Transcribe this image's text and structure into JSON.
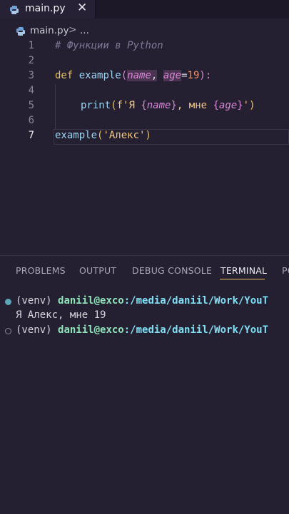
{
  "tab": {
    "filename": "main.py",
    "close_glyph": "✕"
  },
  "breadcrumb": {
    "file": "main.py",
    "separator": ">",
    "more": "..."
  },
  "editor": {
    "line_numbers": [
      "1",
      "2",
      "3",
      "4",
      "5",
      "6",
      "7"
    ],
    "line1": {
      "comment": "# Функции в Python"
    },
    "line3": {
      "kw": "def",
      "fn": "example",
      "open": "(",
      "p1": "name",
      "comma": ",",
      "p2": "age",
      "eq": "=",
      "num": "19",
      "close": "):"
    },
    "line5": {
      "fn": "print",
      "open": "(",
      "s1": "f'Я ",
      "b1o": "{",
      "v1": "name",
      "b1c": "}",
      "s2": ", мне ",
      "b2o": "{",
      "v2": "age",
      "b2c": "}",
      "s3": "'",
      "close": ")"
    },
    "line7": {
      "fn": "example",
      "open": "(",
      "str": "'Алекс'",
      "close": ")"
    }
  },
  "panel": {
    "tabs": [
      "PROBLEMS",
      "OUTPUT",
      "DEBUG CONSOLE",
      "TERMINAL",
      "PO"
    ],
    "active_tab": "TERMINAL"
  },
  "terminal": {
    "line1": {
      "venv": "(venv) ",
      "user": "daniil@exco",
      "path": ":/media/daniil/Work/YouT"
    },
    "line2": {
      "output": "Я Алекс, мне 19"
    },
    "line3": {
      "venv": "(venv) ",
      "user": "daniil@exco",
      "path": ":/media/daniil/Work/YouT"
    }
  },
  "colors": {
    "accent": "#e7c35a",
    "background": "#241f31",
    "keyword": "#e7c35a",
    "param": "#d986d6"
  }
}
